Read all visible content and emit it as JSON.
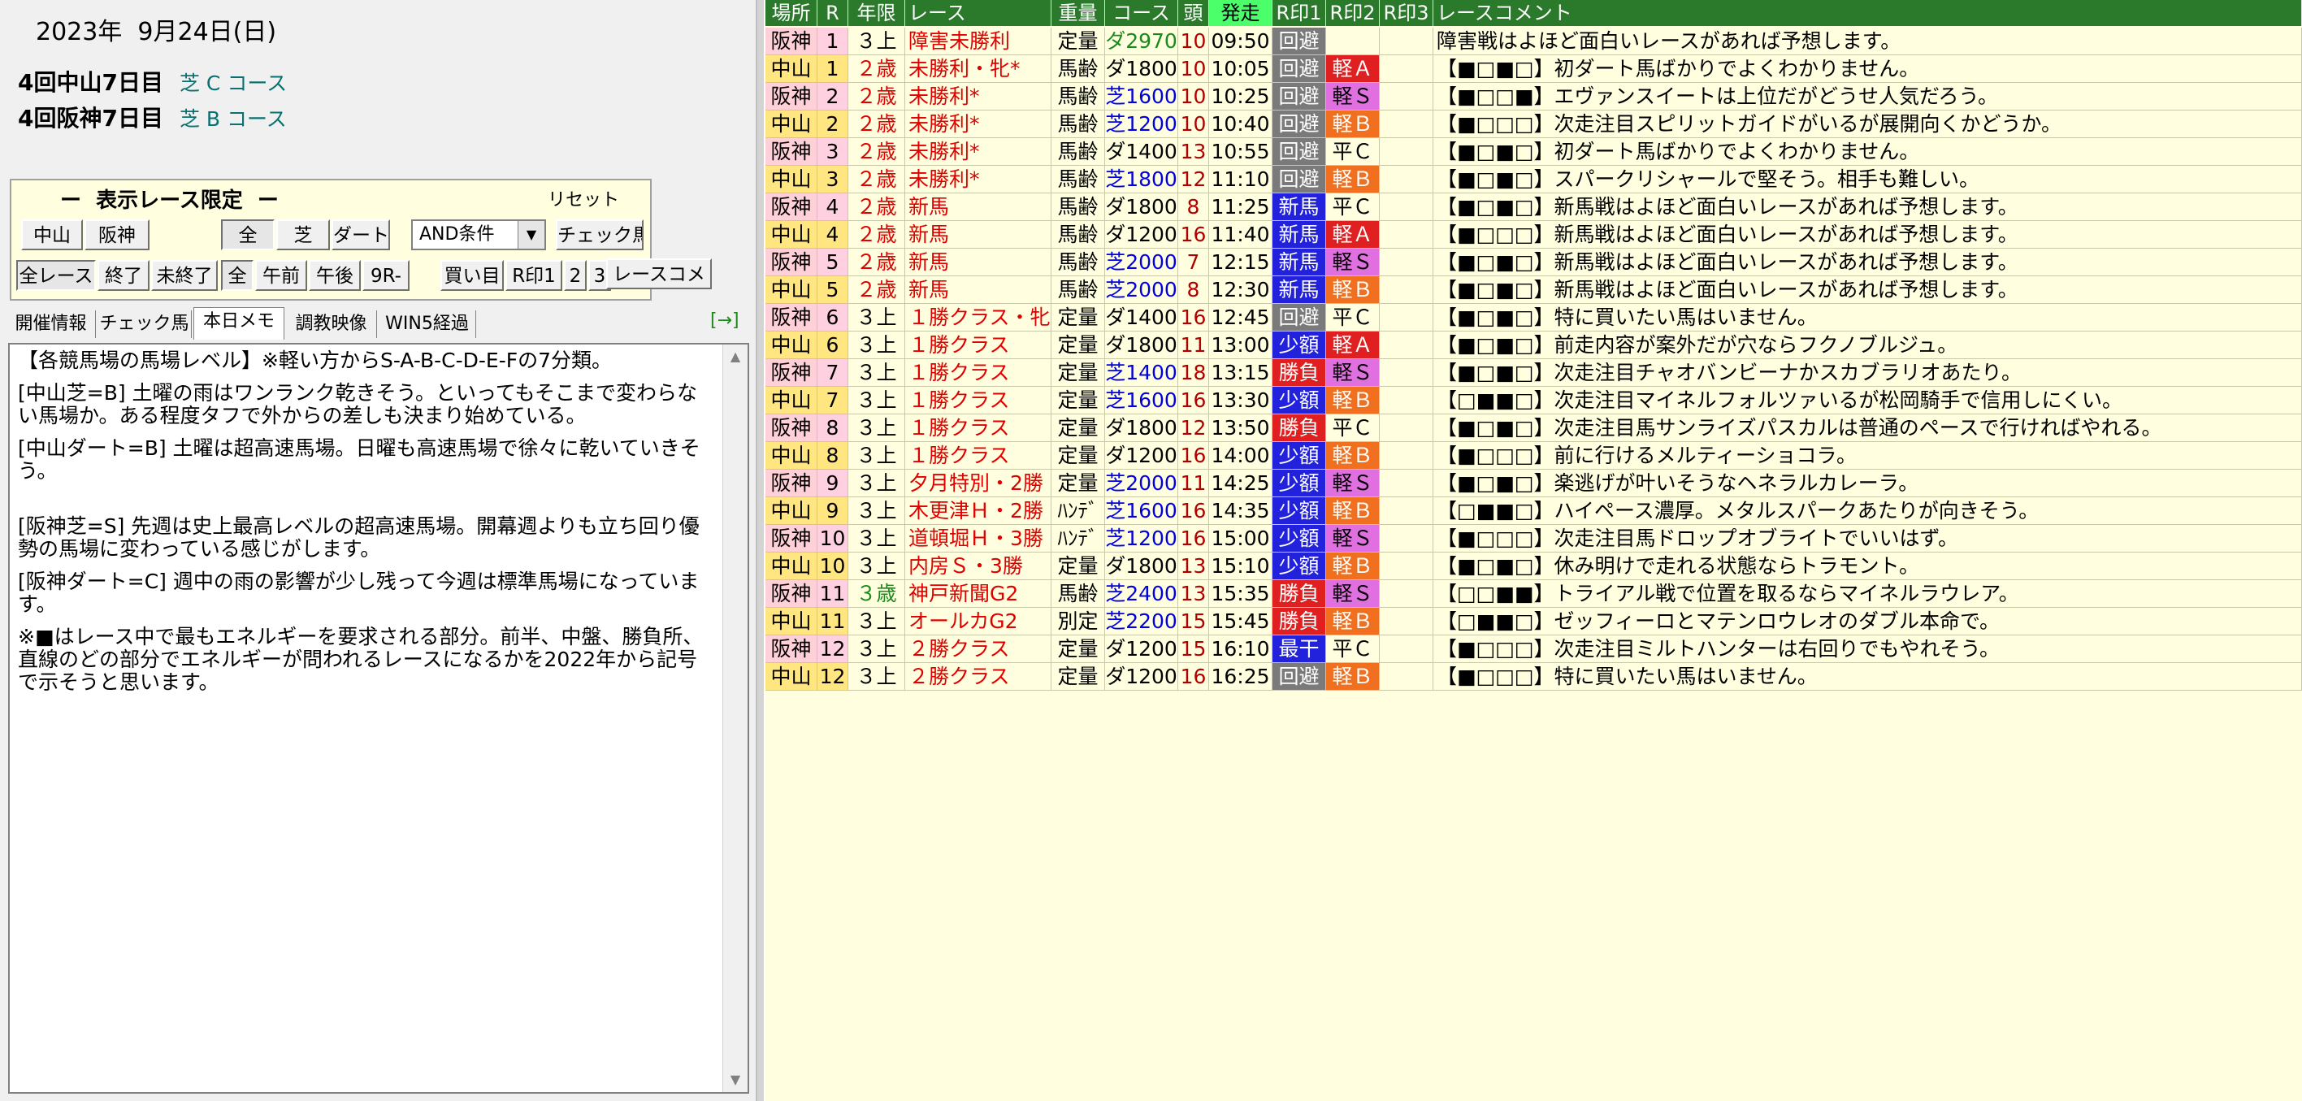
{
  "header": {
    "date": "2023年  9月24日(日)",
    "courses": [
      {
        "meeting": "4回中山7日目",
        "course": "芝 C コース"
      },
      {
        "meeting": "4回阪神7日目",
        "course": "芝 B コース"
      }
    ]
  },
  "filter": {
    "title": "ー  表示レース限定  ー",
    "reset": "リセット",
    "place_buttons": [
      "中山",
      "阪神"
    ],
    "surface_buttons": [
      "全",
      "芝",
      "ダート"
    ],
    "condition_select": "AND条件",
    "check_button": "チェック馬",
    "status_buttons": [
      "全レース",
      "終了",
      "未終了"
    ],
    "time_buttons": [
      "全",
      "午前",
      "午後",
      "9R-"
    ],
    "extra_buttons": [
      "買い目",
      "R印1",
      "2",
      "3",
      "レースコメ"
    ]
  },
  "tabs": {
    "items": [
      "開催情報",
      "チェック馬",
      "本日メモ",
      "調教映像",
      "WIN5経過"
    ],
    "active": 2,
    "arrow": "[→]"
  },
  "memo": {
    "paragraphs": [
      "【各競馬場の馬場レベル】※軽い方からS-A-B-C-D-E-Fの7分類。",
      "[中山芝=B] 土曜の雨はワンランク乾きそう。といってもそこまで変わらない馬場か。ある程度タフで外からの差しも決まり始めている。",
      "[中山ダート=B] 土曜は超高速馬場。日曜も高速馬場で徐々に乾いていきそう。",
      "[阪神芝=S] 先週は史上最高レベルの超高速馬場。開幕週よりも立ち回り優勢の馬場に変わっている感じがします。",
      "[阪神ダート=C] 週中の雨の影響が少し残って今週は標準馬場になっています。",
      "※■はレース中で最もエネルギーを要求される部分。前半、中盤、勝負所、直線のどの部分でエネルギーが問われるレースになるかを2022年から記号で示そうと思います。"
    ]
  },
  "grid": {
    "headers": [
      "場所",
      "R",
      "年限",
      "レース",
      "重量",
      "コース",
      "頭",
      "発走",
      "R印1",
      "R印2",
      "R印3",
      "レースコメント"
    ],
    "rows": [
      {
        "place": "阪神",
        "r": "1",
        "age": "３上",
        "race": "障害未勝利",
        "weight": "定量",
        "course": "ダ2970",
        "heads": "10",
        "time": "09:50",
        "m1": "回避",
        "m2": "",
        "m3": "",
        "comment": "障害戦はよほど面白いレースがあれば予想します。"
      },
      {
        "place": "中山",
        "r": "1",
        "age": "２歳",
        "race": "未勝利・牝*",
        "weight": "馬齢",
        "course": "ダ1800",
        "heads": "10",
        "time": "10:05",
        "m1": "回避",
        "m2": "軽Ａ",
        "m3": "",
        "comment": "【■□■□】初ダート馬ばかりでよくわかりません。"
      },
      {
        "place": "阪神",
        "r": "2",
        "age": "２歳",
        "race": "未勝利*",
        "weight": "馬齢",
        "course": "芝1600",
        "heads": "10",
        "time": "10:25",
        "m1": "回避",
        "m2": "軽Ｓ",
        "m3": "",
        "comment": "【■□□■】エヴァンスイートは上位だがどうせ人気だろう。"
      },
      {
        "place": "中山",
        "r": "2",
        "age": "２歳",
        "race": "未勝利*",
        "weight": "馬齢",
        "course": "芝1200",
        "heads": "10",
        "time": "10:40",
        "m1": "回避",
        "m2": "軽Ｂ",
        "m3": "",
        "comment": "【■□□□】次走注目スピリットガイドがいるが展開向くかどうか。"
      },
      {
        "place": "阪神",
        "r": "3",
        "age": "２歳",
        "race": "未勝利*",
        "weight": "馬齢",
        "course": "ダ1400",
        "heads": "13",
        "time": "10:55",
        "m1": "回避",
        "m2": "平Ｃ",
        "m3": "",
        "comment": "【■□■□】初ダート馬ばかりでよくわかりません。"
      },
      {
        "place": "中山",
        "r": "3",
        "age": "２歳",
        "race": "未勝利*",
        "weight": "馬齢",
        "course": "芝1800",
        "heads": "12",
        "time": "11:10",
        "m1": "回避",
        "m2": "軽Ｂ",
        "m3": "",
        "comment": "【■□■□】スパークリシャールで堅そう。相手も難しい。"
      },
      {
        "place": "阪神",
        "r": "4",
        "age": "２歳",
        "race": "新馬",
        "weight": "馬齢",
        "course": "ダ1800",
        "heads": "8",
        "time": "11:25",
        "m1": "新馬",
        "m2": "平Ｃ",
        "m3": "",
        "comment": "【■□■□】新馬戦はよほど面白いレースがあれば予想します。"
      },
      {
        "place": "中山",
        "r": "4",
        "age": "２歳",
        "race": "新馬",
        "weight": "馬齢",
        "course": "ダ1200",
        "heads": "16",
        "time": "11:40",
        "m1": "新馬",
        "m2": "軽Ａ",
        "m3": "",
        "comment": "【■□□□】新馬戦はよほど面白いレースがあれば予想します。"
      },
      {
        "place": "阪神",
        "r": "5",
        "age": "２歳",
        "race": "新馬",
        "weight": "馬齢",
        "course": "芝2000",
        "heads": "7",
        "time": "12:15",
        "m1": "新馬",
        "m2": "軽Ｓ",
        "m3": "",
        "comment": "【■□■□】新馬戦はよほど面白いレースがあれば予想します。"
      },
      {
        "place": "中山",
        "r": "5",
        "age": "２歳",
        "race": "新馬",
        "weight": "馬齢",
        "course": "芝2000",
        "heads": "8",
        "time": "12:30",
        "m1": "新馬",
        "m2": "軽Ｂ",
        "m3": "",
        "comment": "【■□■□】新馬戦はよほど面白いレースがあれば予想します。"
      },
      {
        "place": "阪神",
        "r": "6",
        "age": "３上",
        "race": "１勝クラス・牝",
        "weight": "定量",
        "course": "ダ1400",
        "heads": "16",
        "time": "12:45",
        "m1": "回避",
        "m2": "平Ｃ",
        "m3": "",
        "comment": "【■□■□】特に買いたい馬はいません。"
      },
      {
        "place": "中山",
        "r": "6",
        "age": "３上",
        "race": "１勝クラス",
        "weight": "定量",
        "course": "ダ1800",
        "heads": "11",
        "time": "13:00",
        "m1": "少額",
        "m2": "軽Ａ",
        "m3": "",
        "comment": "【■□■□】前走内容が案外だが穴ならフクノブルジュ。"
      },
      {
        "place": "阪神",
        "r": "7",
        "age": "３上",
        "race": "１勝クラス",
        "weight": "定量",
        "course": "芝1400",
        "heads": "18",
        "time": "13:15",
        "m1": "勝負",
        "m2": "軽Ｓ",
        "m3": "",
        "comment": "【■□■□】次走注目チャオバンビーナかスカブラリオあたり。"
      },
      {
        "place": "中山",
        "r": "7",
        "age": "３上",
        "race": "１勝クラス",
        "weight": "定量",
        "course": "芝1600",
        "heads": "16",
        "time": "13:30",
        "m1": "少額",
        "m2": "軽Ｂ",
        "m3": "",
        "comment": "【□■■□】次走注目マイネルフォルツァいるが松岡騎手で信用しにくい。"
      },
      {
        "place": "阪神",
        "r": "8",
        "age": "３上",
        "race": "１勝クラス",
        "weight": "定量",
        "course": "ダ1800",
        "heads": "12",
        "time": "13:50",
        "m1": "勝負",
        "m2": "平Ｃ",
        "m3": "",
        "comment": "【■□■□】次走注目馬サンライズパスカルは普通のペースで行ければやれる。"
      },
      {
        "place": "中山",
        "r": "8",
        "age": "３上",
        "race": "１勝クラス",
        "weight": "定量",
        "course": "ダ1200",
        "heads": "16",
        "time": "14:00",
        "m1": "少額",
        "m2": "軽Ｂ",
        "m3": "",
        "comment": "【■□□□】前に行けるメルティーショコラ。"
      },
      {
        "place": "阪神",
        "r": "9",
        "age": "３上",
        "race": "夕月特別・2勝",
        "weight": "定量",
        "course": "芝2000",
        "heads": "11",
        "time": "14:25",
        "m1": "少額",
        "m2": "軽Ｓ",
        "m3": "",
        "comment": "【■□■□】楽逃げが叶いそうなヘネラルカレーラ。"
      },
      {
        "place": "中山",
        "r": "9",
        "age": "３上",
        "race": "木更津Ｈ・2勝",
        "weight": "ﾊﾝﾃﾞ",
        "course": "芝1600",
        "heads": "16",
        "time": "14:35",
        "m1": "少額",
        "m2": "軽Ｂ",
        "m3": "",
        "comment": "【□■■□】ハイペース濃厚。メタルスパークあたりが向きそう。"
      },
      {
        "place": "阪神",
        "r": "10",
        "age": "３上",
        "race": "道頓堀Ｈ・3勝",
        "weight": "ﾊﾝﾃﾞ",
        "course": "芝1200",
        "heads": "16",
        "time": "15:00",
        "m1": "少額",
        "m2": "軽Ｓ",
        "m3": "",
        "comment": "【■□□□】次走注目馬ドロップオブライトでいいはず。"
      },
      {
        "place": "中山",
        "r": "10",
        "age": "３上",
        "race": "内房Ｓ・3勝",
        "weight": "定量",
        "course": "ダ1800",
        "heads": "13",
        "time": "15:10",
        "m1": "少額",
        "m2": "軽Ｂ",
        "m3": "",
        "comment": "【■□■□】休み明けで走れる状態ならトラモント。"
      },
      {
        "place": "阪神",
        "r": "11",
        "age": "３歳",
        "race": "神戸新聞G2",
        "weight": "馬齢",
        "course": "芝2400",
        "heads": "13",
        "time": "15:35",
        "m1": "勝負",
        "m2": "軽Ｓ",
        "m3": "",
        "comment": "【□□■■】トライアル戦で位置を取るならマイネルラウレア。"
      },
      {
        "place": "中山",
        "r": "11",
        "age": "３上",
        "race": "オールカG2",
        "weight": "別定",
        "course": "芝2200",
        "heads": "15",
        "time": "15:45",
        "m1": "勝負",
        "m2": "軽Ｂ",
        "m3": "",
        "comment": "【□■■□】ゼッフィーロとマテンロウレオのダブル本命で。"
      },
      {
        "place": "阪神",
        "r": "12",
        "age": "３上",
        "race": "２勝クラス",
        "weight": "定量",
        "course": "ダ1200",
        "heads": "15",
        "time": "16:10",
        "m1": "最干",
        "m2": "平Ｃ",
        "m3": "",
        "comment": "【■□□□】次走注目ミルトハンターは右回りでもやれそう。"
      },
      {
        "place": "中山",
        "r": "12",
        "age": "３上",
        "race": "２勝クラス",
        "weight": "定量",
        "course": "ダ1200",
        "heads": "16",
        "time": "16:25",
        "m1": "回避",
        "m2": "軽Ｂ",
        "m3": "",
        "comment": "【■□□□】特に買いたい馬はいません。"
      }
    ]
  }
}
